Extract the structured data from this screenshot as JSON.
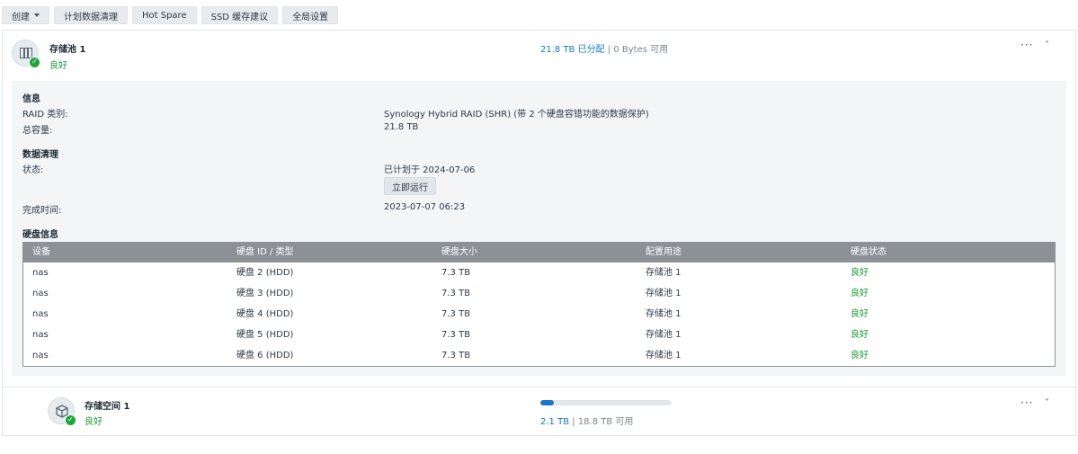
{
  "toolbar": {
    "create": "创建",
    "scrub_schedule": "计划数据清理",
    "hot_spare": "Hot Spare",
    "ssd_cache": "SSD 缓存建议",
    "global_settings": "全局设置"
  },
  "pool": {
    "name": "存储池 1",
    "status": "良好",
    "allocated": "21.8 TB 已分配",
    "separator": "|",
    "available": "0 Bytes 可用",
    "more": "···",
    "collapse": "˄",
    "info_title": "信息",
    "raid_label": "RAID 类别:",
    "raid_value": "Synology Hybrid RAID (SHR) (带 2 个硬盘容错功能的数据保护)",
    "capacity_label": "总容量:",
    "capacity_value": "21.8 TB",
    "scrub_title": "数据清理",
    "state_label": "状态:",
    "state_value": "已计划于 2024-07-06",
    "run_now": "立即运行",
    "done_label": "完成时间:",
    "done_value": "2023-07-07 06:23",
    "disk_title": "硬盘信息"
  },
  "disk_table": {
    "headers": [
      "设备",
      "硬盘 ID / 类型",
      "硬盘大小",
      "配置用途",
      "硬盘状态"
    ],
    "rows": [
      [
        "nas",
        "硬盘 2 (HDD)",
        "7.3 TB",
        "存储池 1",
        "良好"
      ],
      [
        "nas",
        "硬盘 3 (HDD)",
        "7.3 TB",
        "存储池 1",
        "良好"
      ],
      [
        "nas",
        "硬盘 4 (HDD)",
        "7.3 TB",
        "存储池 1",
        "良好"
      ],
      [
        "nas",
        "硬盘 5 (HDD)",
        "7.3 TB",
        "存储池 1",
        "良好"
      ],
      [
        "nas",
        "硬盘 6 (HDD)",
        "7.3 TB",
        "存储池 1",
        "良好"
      ]
    ]
  },
  "volume": {
    "name": "存储空间 1",
    "status": "良好",
    "used": "2.1 TB",
    "separator": "|",
    "available": "18.8 TB 可用",
    "usage_fraction": 0.1,
    "more": "···",
    "expand": "˅"
  },
  "colors": {
    "accent": "#1977c9",
    "good": "#1b9a33",
    "table_header": "#8c9196"
  }
}
